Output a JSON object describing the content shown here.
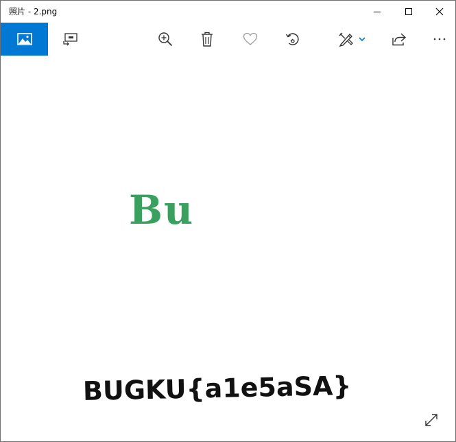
{
  "window": {
    "title": "照片 - 2.png"
  },
  "toolbar": {
    "buttons": [
      {
        "name": "view",
        "icon": "image-icon",
        "active": true
      },
      {
        "name": "slideshow",
        "icon": "slideshow-icon"
      },
      {
        "name": "zoom",
        "icon": "zoom-in-icon"
      },
      {
        "name": "delete",
        "icon": "trash-icon"
      },
      {
        "name": "favorite",
        "icon": "heart-icon"
      },
      {
        "name": "rotate",
        "icon": "rotate-icon"
      },
      {
        "name": "edit",
        "icon": "edit-create-icon"
      },
      {
        "name": "share",
        "icon": "share-icon"
      },
      {
        "name": "more",
        "icon": "more-icon"
      }
    ],
    "accent_color": "#0078d4"
  },
  "image": {
    "logo_text": "Bu",
    "logo_color": "#3aa05e",
    "flag_text": "BUGKU{a1e5aSA}"
  }
}
